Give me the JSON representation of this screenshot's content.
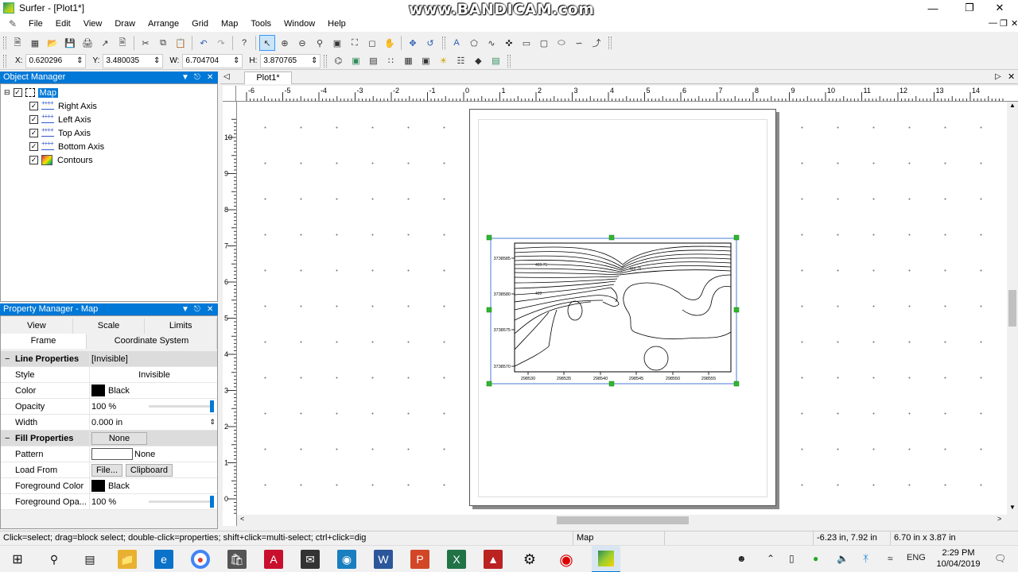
{
  "window": {
    "title": "Surfer - [Plot1*]",
    "watermark": "www.BANDICAM.com",
    "minimize_icon": "minimize-icon",
    "restore_icon": "restore-icon",
    "close_icon": "close-icon"
  },
  "menu": {
    "items": [
      "File",
      "Edit",
      "View",
      "Draw",
      "Arrange",
      "Grid",
      "Map",
      "Tools",
      "Window",
      "Help"
    ]
  },
  "coords": {
    "x_label": "X:",
    "x": "0.620296",
    "y_label": "Y:",
    "y": "3.480035",
    "w_label": "W:",
    "w": "6.704704",
    "h_label": "H:",
    "h": "3.870765"
  },
  "object_manager": {
    "title": "Object Manager",
    "root": "Map",
    "children": [
      "Right Axis",
      "Left Axis",
      "Top Axis",
      "Bottom Axis",
      "Contours"
    ]
  },
  "property_manager": {
    "title": "Property Manager - Map",
    "tabs_row1": [
      "View",
      "Scale",
      "Limits"
    ],
    "tabs_row2": [
      "Frame",
      "Coordinate System"
    ],
    "line_group": {
      "label": "Line Properties",
      "value": "[Invisible]"
    },
    "style": {
      "label": "Style",
      "value": "Invisible"
    },
    "color": {
      "label": "Color",
      "value": "Black",
      "swatch": "#000000"
    },
    "opacity": {
      "label": "Opacity",
      "value": "100 %",
      "level": 1.0
    },
    "width": {
      "label": "Width",
      "value": "0.000 in"
    },
    "fill_group": {
      "label": "Fill Properties",
      "value": "None"
    },
    "pattern": {
      "label": "Pattern",
      "value": "None"
    },
    "load_from": {
      "label": "Load From",
      "file_button": "File...",
      "clipboard_button": "Clipboard"
    },
    "fg_color": {
      "label": "Foreground Color",
      "value": "Black",
      "swatch": "#000000"
    },
    "fg_opacity": {
      "label": "Foreground Opa...",
      "value": "100 %",
      "level": 1.0
    }
  },
  "document": {
    "tab": "Plot1*",
    "ruler_h_labels": [
      "-6",
      "-5",
      "-4",
      "-3",
      "-2",
      "-1",
      "0",
      "1",
      "2",
      "3",
      "4",
      "5",
      "6",
      "7",
      "8",
      "9",
      "10",
      "11",
      "12",
      "13",
      "14"
    ],
    "ruler_v_labels": [
      "10",
      "9",
      "8",
      "7",
      "6",
      "5",
      "4",
      "3",
      "2",
      "1",
      "0"
    ]
  },
  "map": {
    "y_ticks": [
      "3738585",
      "3738580",
      "3738575",
      "3738570"
    ],
    "x_ticks": [
      "298530",
      "298535",
      "298540",
      "298545",
      "298550",
      "298555"
    ],
    "contour_labels": [
      "489.75",
      "489",
      "489.75"
    ]
  },
  "status": {
    "hint": "Click=select; drag=block select; double-click=properties; shift+click=multi-select; ctrl+click=dig",
    "object": "Map",
    "cursor": "-6.23 in, 7.92 in",
    "size": "6.70 in x 3.87 in"
  },
  "taskbar": {
    "lang": "ENG",
    "time": "2:29 PM",
    "date": "10/04/2019"
  },
  "colors": {
    "accent": "#0078d7",
    "selection_handle": "#2db82d"
  }
}
